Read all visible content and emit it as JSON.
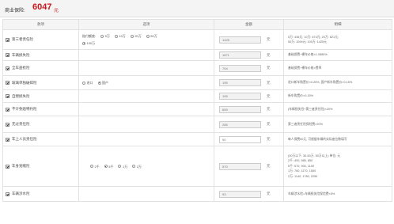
{
  "header": {
    "title": "商业保险:",
    "total": "6047",
    "unit": "元"
  },
  "columns": {
    "item": "款项",
    "options": "选项",
    "amount": "金额",
    "desc": "明细"
  },
  "rows": [
    {
      "name": "第三者责任险",
      "option_label": "赔付额度:",
      "options": [
        "5万",
        "10万",
        "20万",
        "50万",
        "100万"
      ],
      "selected": "100万",
      "amount": "1425",
      "amount_unit": "元",
      "desc_lines": [
        "5万: 436元; 10万: 674元; 20万: 821元;",
        "50万: 1094元; 100万: 1425元"
      ]
    },
    {
      "name": "车辆损失险",
      "amount": "1871",
      "amount_unit": "元",
      "desc_lines": [
        "基础保费+裸车价格×1.0880%"
      ]
    },
    {
      "name": "全车盗抢险",
      "amount": "704",
      "amount_unit": "元",
      "desc_lines": [
        "基础保费+裸车价格×费率"
      ]
    },
    {
      "name": "玻璃单独破碎险",
      "options": [
        "进口",
        "国产"
      ],
      "selected": "国产",
      "amount": "195",
      "amount_unit": "元",
      "desc_lines": [
        "进口新车购置价×0.25%, 国产新车购置价×0.15%"
      ]
    },
    {
      "name": "自燃损失险",
      "amount": "195",
      "amount_unit": "元",
      "desc_lines": [
        "新车购置价×0.15%"
      ]
    },
    {
      "name": "不计免赔特约险",
      "amount": "659",
      "amount_unit": "元",
      "desc_lines": [
        "(车辆损失险+第三者责任险)×20%"
      ]
    },
    {
      "name": "无过责任险",
      "amount": "285",
      "amount_unit": "元",
      "desc_lines": [
        "第三者责任险保险费×20%"
      ]
    },
    {
      "name": "车上人员责任险",
      "amount": "50",
      "amount_unit": "元",
      "desc_lines": [
        "每人保费50元, 可根据车辆的实际座位数填写"
      ]
    },
    {
      "name": "车身划痕险",
      "options": [
        "2千",
        "5千",
        "1万",
        "2万"
      ],
      "selected": "5千",
      "amount": "570",
      "amount_unit": "元",
      "desc_lines": [
        "(30万以下, 30-50万, 50万以上) 单位: 元",
        "2千: 400, 585, 850",
        "5千: 570, 900, 1100",
        "1万: 760, 1170, 1500",
        "2万: 1140, 1780, 2250"
      ]
    },
    {
      "name": "车辆涉水险",
      "amount": "93",
      "amount_unit": "元",
      "desc_lines": [
        "车辆涉水险=车辆损失险保险费×5%"
      ]
    }
  ]
}
